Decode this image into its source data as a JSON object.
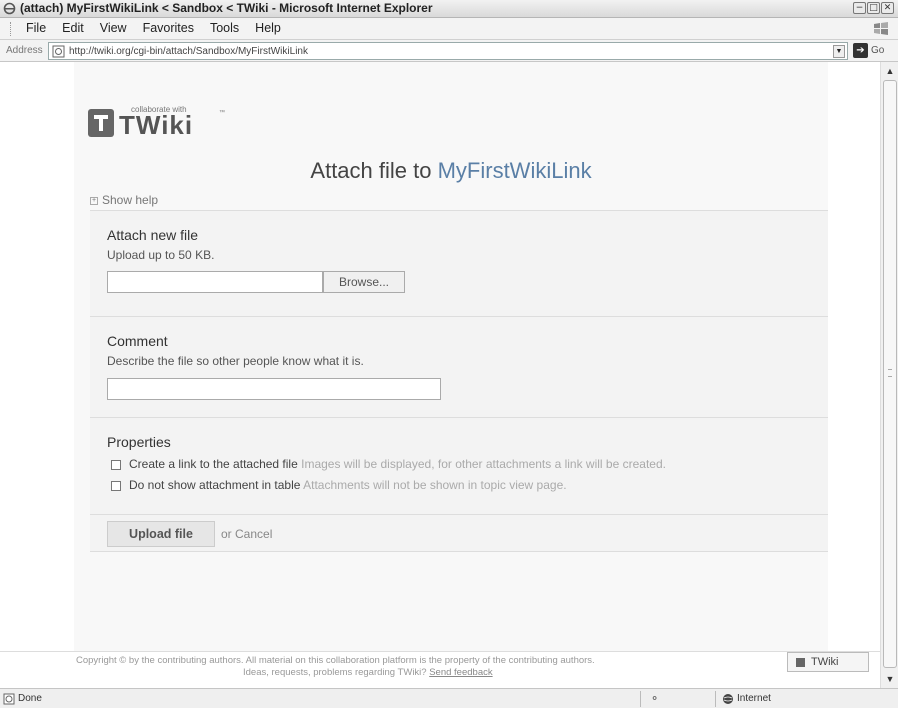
{
  "window": {
    "title": "(attach) MyFirstWikiLink < Sandbox < TWiki - Microsoft Internet Explorer",
    "controls": [
      "−",
      "□",
      "✕"
    ]
  },
  "menubar": {
    "items": [
      "File",
      "Edit",
      "View",
      "Favorites",
      "Tools",
      "Help"
    ]
  },
  "addressbar": {
    "label": "Address",
    "url": "http://twiki.org/cgi-bin/attach/Sandbox/MyFirstWikiLink",
    "go": "Go"
  },
  "logo": {
    "tagline": "collaborate with",
    "wordmark": "TWiki",
    "tm": "™"
  },
  "heading": {
    "prefix": "Attach file to ",
    "topic": "MyFirstWikiLink"
  },
  "show_help": "Show help",
  "attach": {
    "title": "Attach new file",
    "desc": "Upload up to 50 KB.",
    "browse_label": "Browse..."
  },
  "comment": {
    "title": "Comment",
    "desc": "Describe the file so other people know what it is."
  },
  "properties": {
    "title": "Properties",
    "items": [
      {
        "label": "Create a link to the attached file",
        "hint": "Images will be displayed, for other attachments a link will be created."
      },
      {
        "label": "Do not show attachment in table",
        "hint": "Attachments will not be shown in topic view page."
      }
    ]
  },
  "actions": {
    "upload_label": "Upload file",
    "or_text": "or ",
    "cancel_label": "Cancel"
  },
  "footer": {
    "line1": "Copyright © by the contributing authors. All material on this collaboration platform is the property of the contributing authors.",
    "line2_prefix": "Ideas, requests, problems regarding TWiki? ",
    "feedback_link": "Send feedback",
    "badge": "TWiki"
  },
  "statusbar": {
    "text": "Done",
    "zone": "Internet"
  }
}
